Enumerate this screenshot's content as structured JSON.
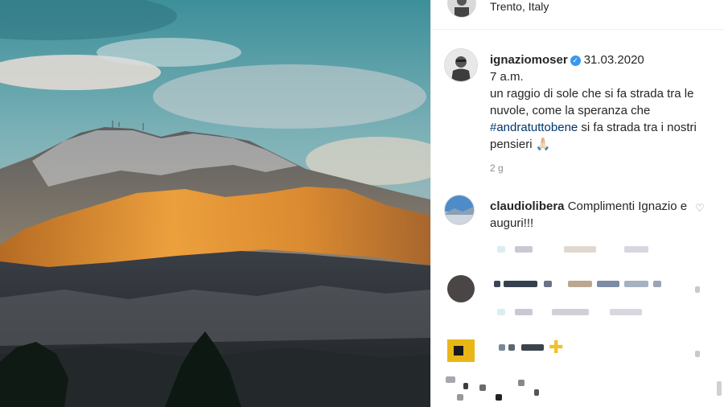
{
  "header": {
    "location": "Trento, Italy"
  },
  "post": {
    "username": "ignaziomoser",
    "verified": true,
    "date": "31.03.2020",
    "line1": "7 a.m.",
    "text_before_tag": "un raggio di sole che si fa strada tra le nuvole, come la speranza che ",
    "hashtag": "#andratuttobene",
    "text_after_tag": " si fa strada tra i nostri pensieri ",
    "emoji": "🙏🏻",
    "time_ago": "2 g"
  },
  "comment": {
    "username": "claudiolibera",
    "text": " Complimenti Ignazio e auguri!!!"
  },
  "colors": {
    "hashtag": "#00376b",
    "verified": "#3897f0",
    "muted": "#8e8e8e"
  }
}
